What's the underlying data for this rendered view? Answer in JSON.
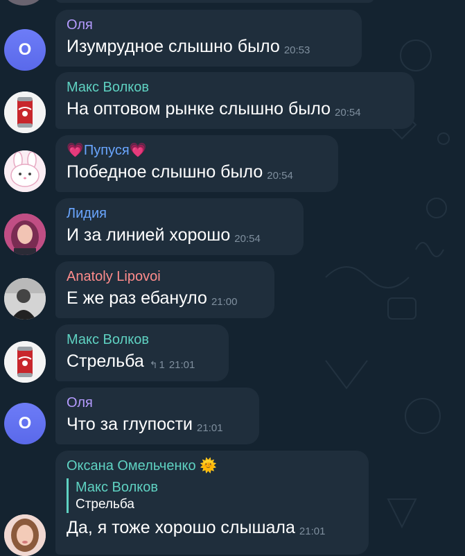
{
  "colors": {
    "background": "#142330",
    "bubble": "#1f2e3c",
    "time_text": "#7f8f9e",
    "avatar_blue": "#6272f1"
  },
  "messages": [
    {
      "sender": "Оля",
      "sender_color": "#b49bff",
      "text": "Изумрудное слышно было",
      "time": "20:53",
      "avatar": {
        "type": "letter",
        "letter": "О"
      }
    },
    {
      "sender": "Макс Волков",
      "sender_color": "#5fd2c2",
      "text": "На оптовом рынке слышно было",
      "time": "20:54",
      "avatar": {
        "type": "image",
        "icon": "cola-can-icon"
      }
    },
    {
      "sender": "💗Пупуся💗",
      "sender_color": "#6aa6ff",
      "text": "Победное слышно было",
      "time": "20:54",
      "avatar": {
        "type": "image",
        "icon": "bunny-icon"
      }
    },
    {
      "sender": "Лидия",
      "sender_color": "#6aa6ff",
      "text": "И за линией хорошо",
      "time": "20:54",
      "avatar": {
        "type": "image",
        "icon": "woman-photo-icon"
      }
    },
    {
      "sender": "Anatoly Lipovoi",
      "sender_color": "#ff8c8c",
      "text": "Е же раз ебануло",
      "time": "21:00",
      "avatar": {
        "type": "image",
        "icon": "man-photo-icon"
      }
    },
    {
      "sender": "Макс Волков",
      "sender_color": "#5fd2c2",
      "text": "Стрельба",
      "time": "21:01",
      "reply_icon": "reply-arrow-icon",
      "reply_count": "1",
      "avatar": {
        "type": "image",
        "icon": "cola-can-icon"
      }
    },
    {
      "sender": "Оля",
      "sender_color": "#b49bff",
      "text": "Что за глупости",
      "time": "21:01",
      "avatar": {
        "type": "letter",
        "letter": "О"
      }
    },
    {
      "sender": "Оксана Омельченко 🌞",
      "sender_color": "#5fd2c2",
      "quote": {
        "sender": "Макс Волков",
        "text": "Стрельба"
      },
      "text": "Да, я тоже хорошо слышала",
      "time": "21:01",
      "avatar": {
        "type": "image",
        "icon": "woman-photo-icon"
      }
    }
  ]
}
